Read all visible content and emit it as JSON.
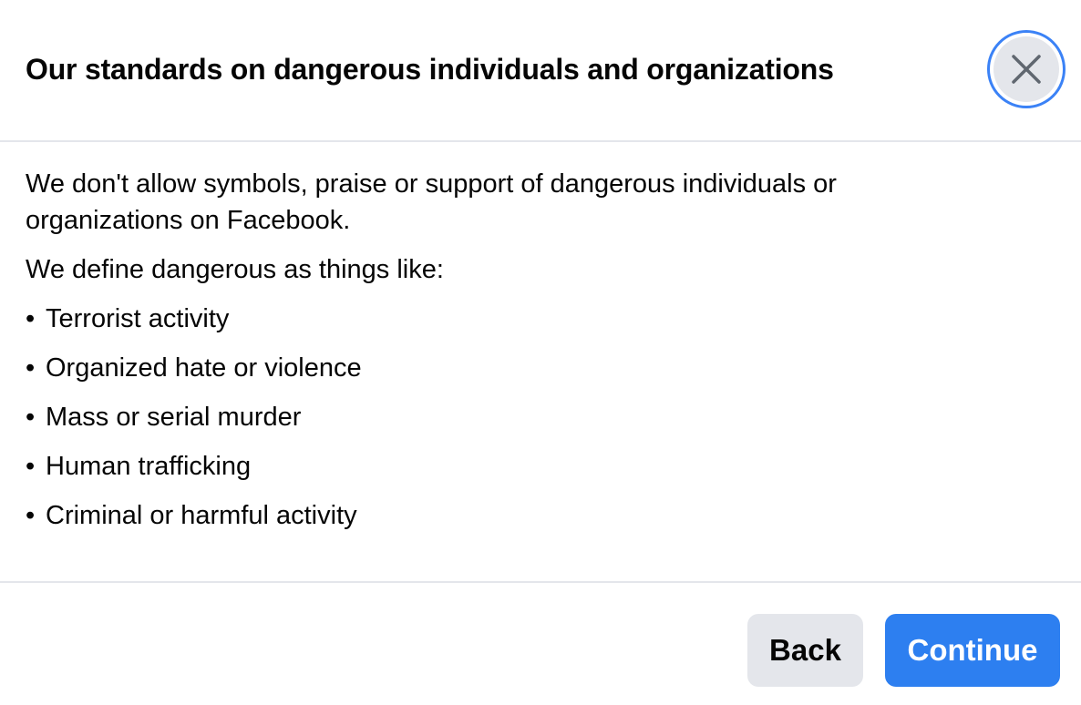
{
  "dialog": {
    "title": "Our standards on dangerous individuals and organizations",
    "close_icon": "close-icon",
    "intro": "We don't allow symbols, praise or support of dangerous individuals or organizations on Facebook.",
    "define_text": "We define dangerous as things like:",
    "bullet_glyph": "•",
    "items": [
      {
        "label": "Terrorist activity"
      },
      {
        "label": "Organized hate or violence"
      },
      {
        "label": "Mass or serial murder"
      },
      {
        "label": "Human trafficking"
      },
      {
        "label": "Criminal or harmful activity"
      }
    ],
    "back_label": "Back",
    "continue_label": "Continue"
  },
  "colors": {
    "accent": "#2d7ff0",
    "focus_ring": "#3b82f6",
    "secondary_button": "#e4e6eb",
    "divider": "#e4e6eb",
    "text": "#050505"
  }
}
